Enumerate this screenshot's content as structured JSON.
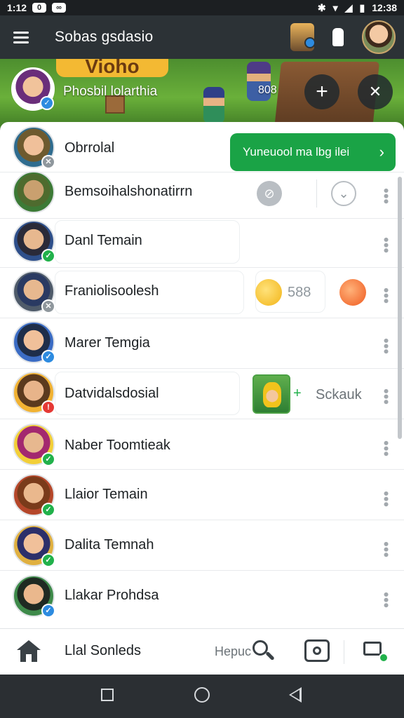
{
  "status_bar": {
    "time_left": "1:12",
    "time_right": "12:38",
    "badge": "0",
    "wifi_glyph": "▾",
    "signal_glyph": "◢",
    "battery_glyph": "▮"
  },
  "app_bar": {
    "title": "Sobas gsdasio"
  },
  "banner": {
    "name": "Phosbil lolarthia",
    "count": "808",
    "title_art": "Vioho"
  },
  "cta": {
    "label": "Yuneuool ma lbg ilei",
    "arrow": "›"
  },
  "contacts": [
    {
      "name": "Obrrolal",
      "badge": "gray"
    },
    {
      "name": "Bemsoihalshonatirrn",
      "badge": "none"
    },
    {
      "name": "Danl Temain",
      "badge": "green"
    },
    {
      "name": "Franiolisoolesh",
      "badge": "gray",
      "score": "588"
    },
    {
      "name": "Marer Temgia",
      "badge": "blue"
    },
    {
      "name": "Datvidalsdosial",
      "badge": "red",
      "side_label": "Sckauk",
      "side_plus": "+"
    },
    {
      "name": "Naber Toomtieak",
      "badge": "green"
    },
    {
      "name": "Llaior Temain",
      "badge": "green"
    },
    {
      "name": "Dalita Temnah",
      "badge": "green"
    },
    {
      "name": "Llakar Prohdsa",
      "badge": "blue"
    }
  ],
  "bottom_nav": {
    "label": "Llal Sonleds",
    "help": "Hepuc"
  },
  "colors": {
    "accent_green": "#1aa346",
    "dark_bar": "#2c3236",
    "badge_blue": "#2d8be0",
    "badge_red": "#e53935"
  }
}
